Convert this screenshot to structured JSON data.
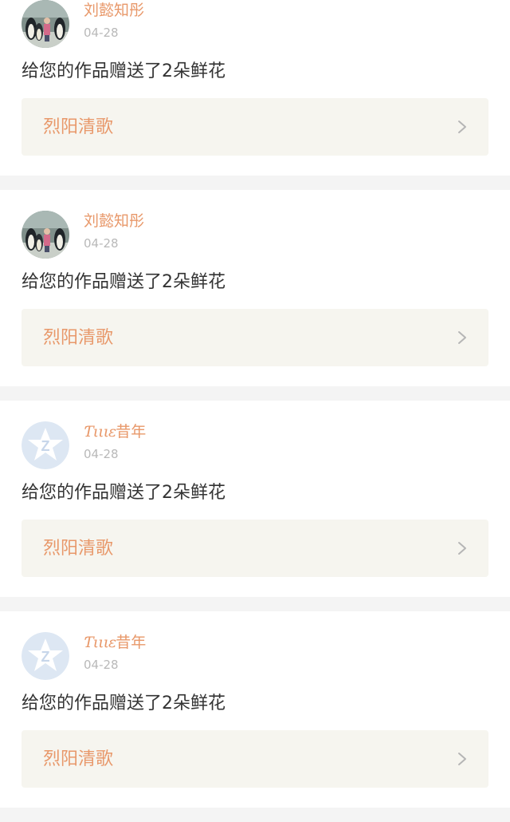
{
  "notifications": [
    {
      "username": "刘懿知彤",
      "username_script": "",
      "username_suffix": "",
      "avatar": "penguin-photo",
      "date": "04-28",
      "message": "给您的作品赠送了2朵鲜花",
      "work_title": "烈阳清歌"
    },
    {
      "username": "刘懿知彤",
      "username_script": "",
      "username_suffix": "",
      "avatar": "penguin-photo",
      "date": "04-28",
      "message": "给您的作品赠送了2朵鲜花",
      "work_title": "烈阳清歌"
    },
    {
      "username": "",
      "username_script": "Ƭιιιε",
      "username_suffix": "昔年",
      "avatar": "qq-default-icon",
      "date": "04-28",
      "message": "给您的作品赠送了2朵鲜花",
      "work_title": "烈阳清歌"
    },
    {
      "username": "",
      "username_script": "Ƭιιιε",
      "username_suffix": "昔年",
      "avatar": "qq-default-icon",
      "date": "04-28",
      "message": "给您的作品赠送了2朵鲜花",
      "work_title": "烈阳清歌"
    }
  ],
  "colors": {
    "accent": "#e8986a",
    "date": "#b9b9b9",
    "text": "#333333",
    "link_bg": "#f6f5ef",
    "separator": "#f4f4f4"
  }
}
